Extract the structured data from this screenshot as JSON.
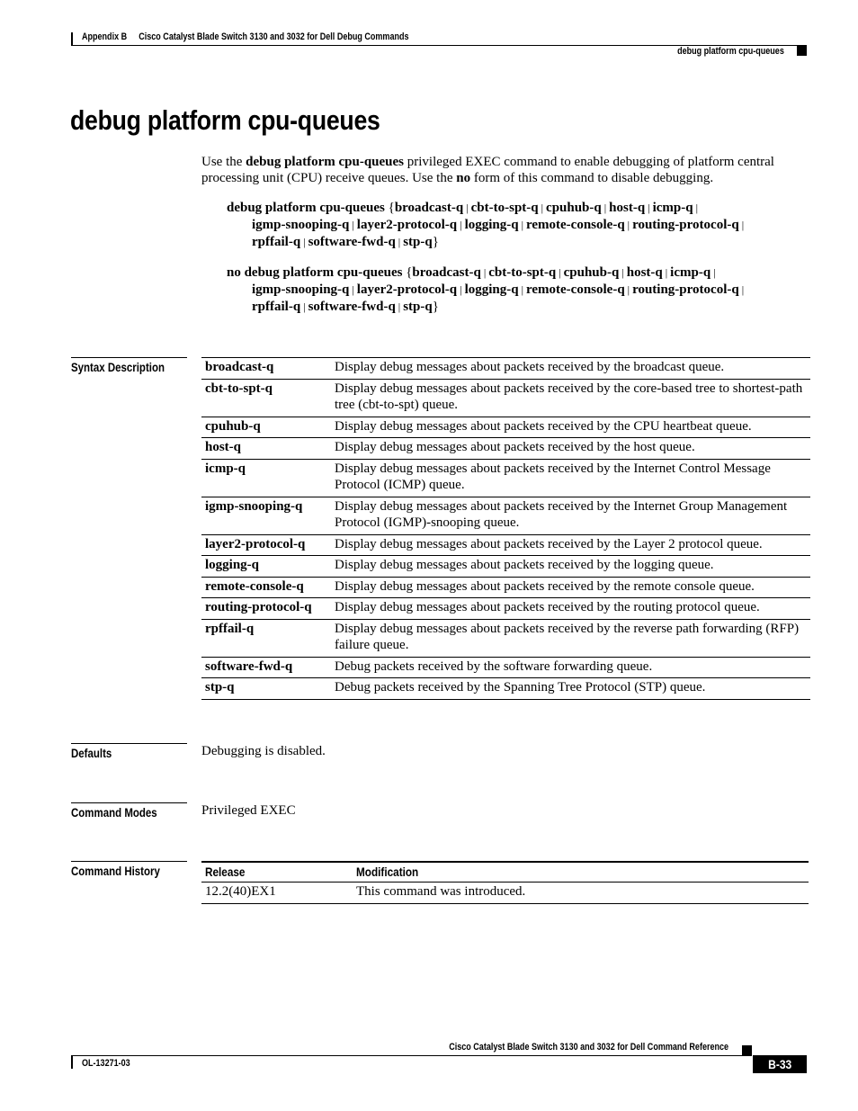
{
  "header": {
    "appendix": "Appendix B",
    "chapter_title": "Cisco Catalyst Blade Switch 3130 and 3032 for Dell Debug Commands",
    "running_title": "debug platform cpu-queues"
  },
  "title": "debug platform cpu-queues",
  "intro": {
    "t1": "Use the ",
    "b1": "debug platform cpu-queues",
    "t2": " privileged EXEC command to enable debugging of platform central processing unit (CPU) receive queues. Use the ",
    "b2": "no",
    "t3": " form of this command to disable debugging."
  },
  "syntax": {
    "debug_prefix": "debug platform cpu-queues",
    "no_prefix": "no debug platform cpu-queues",
    "open_brace": "{",
    "close_brace": "}",
    "separator": "|",
    "line1_keywords": [
      "broadcast-q",
      "cbt-to-spt-q",
      "cpuhub-q",
      "host-q",
      "icmp-q"
    ],
    "line2_keywords": [
      "igmp-snooping-q",
      "layer2-protocol-q",
      "logging-q",
      "remote-console-q",
      "routing-protocol-q"
    ],
    "line3_keywords": [
      "rpffail-q",
      "software-fwd-q",
      "stp-q"
    ]
  },
  "sections": {
    "syntax_description": "Syntax Description",
    "defaults": "Defaults",
    "command_modes": "Command Modes",
    "command_history": "Command History"
  },
  "syntax_table": [
    {
      "keyword": "broadcast-q",
      "description": "Display debug messages about packets received by the broadcast queue."
    },
    {
      "keyword": "cbt-to-spt-q",
      "description": "Display debug messages about packets received by the core-based tree to shortest-path tree (cbt-to-spt) queue."
    },
    {
      "keyword": "cpuhub-q",
      "description": "Display debug messages about packets received by the CPU heartbeat queue."
    },
    {
      "keyword": "host-q",
      "description": "Display debug messages about packets received by the host queue."
    },
    {
      "keyword": "icmp-q",
      "description": "Display debug messages about packets received by the Internet Control Message Protocol (ICMP) queue."
    },
    {
      "keyword": "igmp-snooping-q",
      "description": "Display debug messages about packets received by the Internet Group Management Protocol (IGMP)-snooping queue."
    },
    {
      "keyword": "layer2-protocol-q",
      "description": "Display debug messages about packets received by the Layer 2 protocol queue."
    },
    {
      "keyword": "logging-q",
      "description": "Display debug messages about packets received by the logging queue."
    },
    {
      "keyword": "remote-console-q",
      "description": "Display debug messages about packets received by the remote console queue."
    },
    {
      "keyword": "routing-protocol-q",
      "description": "Display debug messages about packets received by the routing protocol queue."
    },
    {
      "keyword": "rpffail-q",
      "description": "Display debug messages about packets received by the reverse path forwarding (RFP) failure queue."
    },
    {
      "keyword": "software-fwd-q",
      "description": "Debug packets received by the software forwarding queue."
    },
    {
      "keyword": "stp-q",
      "description": "Debug packets received by the Spanning Tree Protocol (STP) queue."
    }
  ],
  "defaults_text": "Debugging is disabled.",
  "command_modes_text": "Privileged EXEC",
  "history": {
    "headers": [
      "Release",
      "Modification"
    ],
    "rows": [
      {
        "release": "12.2(40)EX1",
        "modification": "This command was introduced."
      }
    ]
  },
  "footer": {
    "book_title": "Cisco Catalyst Blade Switch 3130 and 3032 for Dell Command Reference",
    "doc_number": "OL-13271-03",
    "page_number": "B-33"
  }
}
